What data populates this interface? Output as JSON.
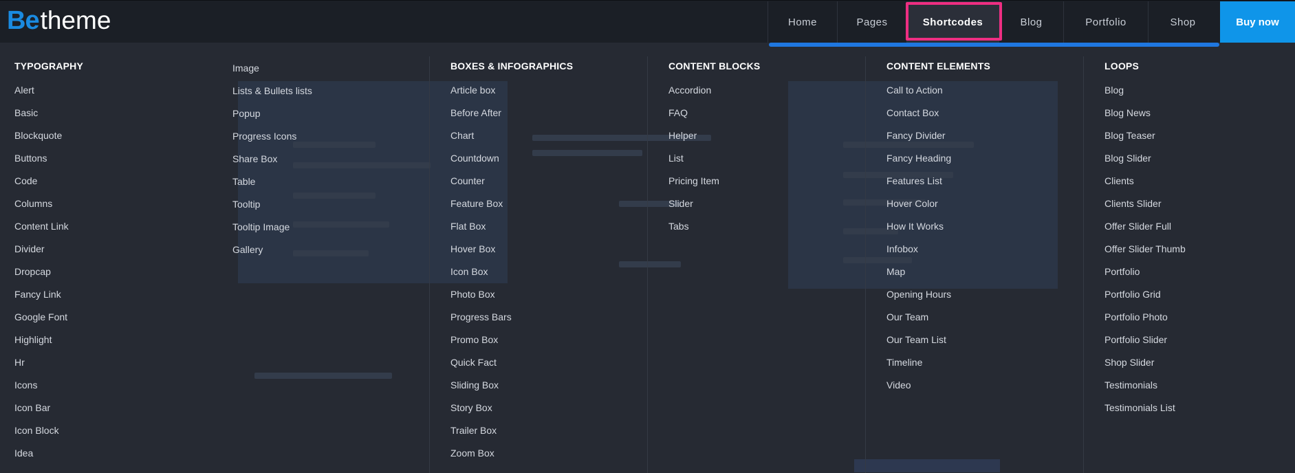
{
  "logo": {
    "be": "Be",
    "theme": "theme"
  },
  "nav": {
    "items": [
      "Home",
      "Pages",
      "Shortcodes",
      "Blog",
      "Portfolio",
      "Shop"
    ],
    "active_index": 2,
    "buy_label": "Buy now"
  },
  "colors": {
    "accent": "#0f95e9",
    "underline": "#1f77e0",
    "highlight": "#ee2e82",
    "menu_bg": "#262a33"
  },
  "mega_menu": {
    "typography": {
      "heading": "TYPOGRAPHY",
      "items": [
        "Alert",
        "Basic",
        "Blockquote",
        "Buttons",
        "Code",
        "Columns",
        "Content Link",
        "Divider",
        "Dropcap",
        "Fancy Link",
        "Google Font",
        "Highlight",
        "Hr",
        "Icons",
        "Icon Bar",
        "Icon Block",
        "Idea"
      ]
    },
    "typography_more": {
      "heading": "",
      "items": [
        "Image",
        "Lists & Bullets lists",
        "Popup",
        "Progress Icons",
        "Share Box",
        "Table",
        "Tooltip",
        "Tooltip Image",
        "Gallery"
      ]
    },
    "boxes": {
      "heading": "BOXES & INFOGRAPHICS",
      "items": [
        "Article box",
        "Before After",
        "Chart",
        "Countdown",
        "Counter",
        "Feature Box",
        "Flat Box",
        "Hover Box",
        "Icon Box",
        "Photo Box",
        "Progress Bars",
        "Promo Box",
        "Quick Fact",
        "Sliding Box",
        "Story Box",
        "Trailer Box",
        "Zoom Box"
      ]
    },
    "content_blocks": {
      "heading": "CONTENT BLOCKS",
      "items": [
        "Accordion",
        "FAQ",
        "Helper",
        "List",
        "Pricing Item",
        "Slider",
        "Tabs"
      ]
    },
    "content_elements": {
      "heading": "CONTENT ELEMENTS",
      "items": [
        "Call to Action",
        "Contact Box",
        "Fancy Divider",
        "Fancy Heading",
        "Features List",
        "Hover Color",
        "How It Works",
        "Infobox",
        "Map",
        "Opening Hours",
        "Our Team",
        "Our Team List",
        "Timeline",
        "Video"
      ]
    },
    "loops": {
      "heading": "LOOPS",
      "items": [
        "Blog",
        "Blog News",
        "Blog Teaser",
        "Blog Slider",
        "Clients",
        "Clients Slider",
        "Offer Slider Full",
        "Offer Slider Thumb",
        "Portfolio",
        "Portfolio Grid",
        "Portfolio Photo",
        "Portfolio Slider",
        "Shop Slider",
        "Testimonials",
        "Testimonials List"
      ]
    }
  }
}
